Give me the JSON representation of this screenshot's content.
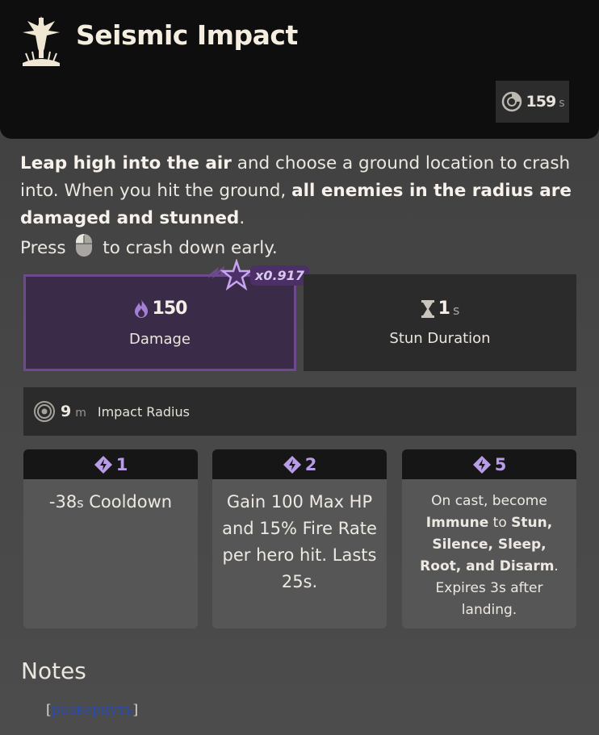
{
  "header": {
    "title": "Seismic Impact",
    "cooldown_value": "159",
    "cooldown_unit": "s"
  },
  "description": {
    "p1_bold1": "Leap high into the air",
    "p1_text1": " and choose a ground location to crash into. When you hit the ground, ",
    "p1_bold2": "all enemies in the radius are damaged and stunned",
    "p1_text2": ".",
    "p2_before": "Press",
    "p2_after": "to crash down early."
  },
  "stats": {
    "damage_value": "150",
    "damage_label": "Damage",
    "spirit_multiplier": "x0.917",
    "stun_value": "1",
    "stun_unit": "s",
    "stun_label": "Stun Duration",
    "radius_value": "9",
    "radius_unit": "m",
    "radius_label": "Impact Radius"
  },
  "upgrades": [
    {
      "cost": "1",
      "text_main": "-38",
      "text_unit": "s",
      "text_rest": " Cooldown"
    },
    {
      "cost": "2",
      "text": "Gain 100 Max HP and 15% Fire Rate per hero hit. Lasts 25s."
    },
    {
      "cost": "5",
      "t1": "On cast, become ",
      "b1": "Immune",
      "t2": " to ",
      "b2": "Stun, Silence, Sleep, Root, and Disarm",
      "t3": ". Expires 3s after landing."
    }
  ],
  "notes": {
    "heading": "Notes",
    "bracket_open": "[",
    "expand_link": "развернуть",
    "bracket_close": "]"
  },
  "colors": {
    "spirit_purple": "#6d4a8e",
    "upgrade_accent": "#b99ce6"
  }
}
